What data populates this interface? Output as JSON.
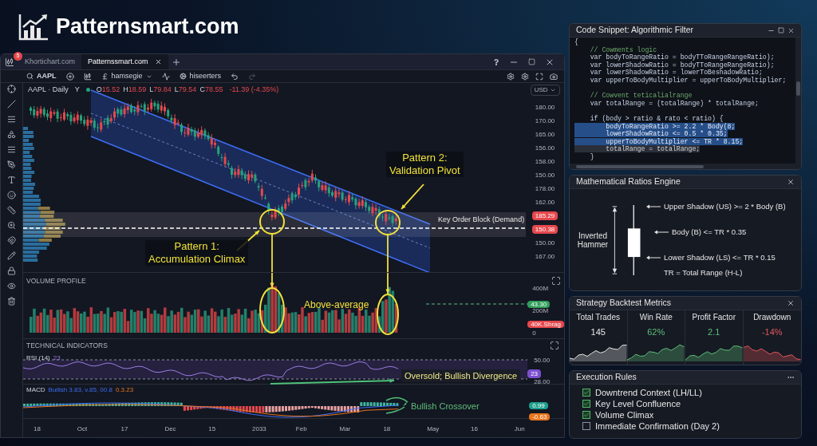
{
  "logo": {
    "text": "Patternsmart.com"
  },
  "browser": {
    "badge": "5",
    "tabs": [
      {
        "label": "Khortichart.com",
        "selected": false
      },
      {
        "label": "Patternssmart.com",
        "selected": true
      }
    ]
  },
  "toolbar": {
    "symbol": "AAPL",
    "template": "hamsegie",
    "indicators": "hiseerters"
  },
  "price_pane": {
    "symbol": "AAPL · Daily",
    "interval": "Y",
    "ohlc": [
      {
        "label": "O",
        "value": "15.52"
      },
      {
        "label": "H",
        "value": "18.59"
      },
      {
        "label": "L",
        "value": "79.84"
      },
      {
        "label": "L",
        "value": "79.54"
      },
      {
        "label": "C",
        "value": "78.55"
      }
    ],
    "change": "-11.39 (-4.35%)",
    "currency": "USD",
    "axis": [
      {
        "kind": "label",
        "text": "180.00"
      },
      {
        "kind": "label",
        "text": "170.00"
      },
      {
        "kind": "label",
        "text": "165.00"
      },
      {
        "kind": "label",
        "text": "156.00"
      },
      {
        "kind": "label",
        "text": "158.00"
      },
      {
        "kind": "label",
        "text": "150.00"
      },
      {
        "kind": "label",
        "text": "178.00"
      },
      {
        "kind": "label",
        "text": "162.00"
      },
      {
        "kind": "badge",
        "text": "185.29",
        "color": "#e5484d"
      },
      {
        "kind": "badge",
        "text": "150.38",
        "color": "#e5484d"
      },
      {
        "kind": "label",
        "text": "150.00"
      },
      {
        "kind": "label",
        "text": "167.00"
      }
    ],
    "zone_label": "Key Order Block (Demand)",
    "callouts": [
      {
        "title": "Pattern 1:",
        "subtitle": "Accumulation Climax"
      },
      {
        "title": "Pattern 2:",
        "subtitle": "Validation Pivot"
      }
    ]
  },
  "volume_pane": {
    "title": "VOLUME PROFILE",
    "note": "Above-average",
    "axis": [
      "400M",
      "200M",
      "0"
    ],
    "badges": [
      {
        "text": "43.30",
        "color": "#2f9e5a"
      },
      {
        "text": "40K.Shrag",
        "color": "#e5484d"
      }
    ]
  },
  "indicators_pane": {
    "title": "TECHNICAL INDICATORS",
    "rsi": {
      "label": "RSI (14)",
      "value": "23",
      "axis": [
        "50.00",
        "28.00"
      ],
      "badge": "23",
      "note": "Oversold; Bullish Divergence"
    },
    "macd": {
      "label": "MACD",
      "values": "Bullish 3.83, v.85, 00.8",
      "signal": "0.3.23",
      "badges": [
        {
          "text": "0.99",
          "color": "#1f9e8e"
        },
        {
          "text": "-0.63",
          "color": "#e8741c"
        }
      ],
      "note": "Bullish Crossover"
    }
  },
  "time_axis": [
    "18",
    "Oct",
    "17",
    "Dec",
    "15",
    "2033",
    "Feb",
    "Mar",
    "18",
    "May",
    "16",
    "Jun"
  ],
  "code_panel": {
    "title": "Code Snippet: Algorithmic Filter",
    "lines": [
      {
        "kind": "plain",
        "text": "{"
      },
      {
        "kind": "comment",
        "text": "    // Cowments logic"
      },
      {
        "kind": "code",
        "text": "    var bodyToRangeRatio = bodyTToRangeRangeRatio);"
      },
      {
        "kind": "code",
        "text": "    var lowerShadowRatio = bodyTToRangeRangeRatio);"
      },
      {
        "kind": "code",
        "text": "    var lowerShadowRatio = lowerToBeshadowRatio;"
      },
      {
        "kind": "code",
        "text": "    var upperToBodyMultiplier = upperToBodyMultiplier;"
      },
      {
        "kind": "blank"
      },
      {
        "kind": "comment",
        "text": "    // Cowvent teticalialrange"
      },
      {
        "kind": "code",
        "text": "    var totalRange = (totalRange) * totalRange;"
      },
      {
        "kind": "blank"
      },
      {
        "kind": "code",
        "text": "    if (body > ratio & rato < ratio) {"
      },
      {
        "kind": "highlight",
        "text": "        bodyToRangeRatio >= 2.2 * Body(8;"
      },
      {
        "kind": "highlight",
        "text": "        lowerShadowRatio <= 0.5 * 0.35;"
      },
      {
        "kind": "highlight",
        "text": "        upperToBodyMultiplier <= TR * 8.15;"
      },
      {
        "kind": "dim",
        "text": "        totalRange = totalRange;"
      },
      {
        "kind": "plain",
        "text": "    }"
      }
    ]
  },
  "ratios_panel": {
    "title": "Mathematical Ratios Engine",
    "figure_label": "Inverted Hammer",
    "rules": [
      "Upper Shadow (US) >= 2 * Body (B)",
      "Body (B) <= TR * 0.35",
      "Lower Shadow (LS) <= TR * 0.15"
    ],
    "legend": "TR = Total Range (H-L)"
  },
  "backtest_panel": {
    "title": "Strategy Backtest Metrics",
    "metrics": [
      {
        "label": "Total Trades",
        "value": "145",
        "color": "#e6e6e6",
        "kind": "gain"
      },
      {
        "label": "Win Rate",
        "value": "62%",
        "color": "#5fbf7a",
        "kind": "gain"
      },
      {
        "label": "Profit Factor",
        "value": "2.1",
        "color": "#5fbf7a",
        "kind": "gain"
      },
      {
        "label": "Drawdown",
        "value": "-14%",
        "color": "#e0575b",
        "kind": "loss"
      }
    ]
  },
  "rules_panel": {
    "title": "Execution Rules",
    "items": [
      {
        "label": "Downtrend Context (LH/LL)",
        "checked": true
      },
      {
        "label": "Key Level Confluence",
        "checked": true
      },
      {
        "label": "Volume Climax",
        "checked": true
      },
      {
        "label": "Immediate Confirmation (Day 2)",
        "checked": false
      }
    ]
  }
}
